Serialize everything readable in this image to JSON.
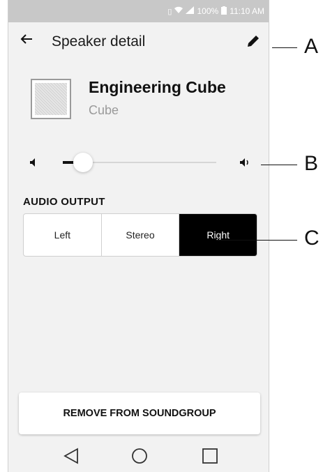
{
  "status_bar": {
    "battery": "100%",
    "time": "11:10 AM",
    "icons": [
      "vibrate-icon",
      "wifi-icon",
      "signal-icon",
      "battery-icon"
    ]
  },
  "app_bar": {
    "title": "Speaker detail",
    "back_icon": "arrow-left-icon",
    "edit_icon": "pencil-icon"
  },
  "speaker": {
    "name": "Engineering Cube",
    "type": "Cube"
  },
  "volume": {
    "level": 0.13,
    "low_icon": "volume-low-icon",
    "high_icon": "volume-high-icon"
  },
  "audio_output": {
    "label": "AUDIO OUTPUT",
    "options": [
      "Left",
      "Stereo",
      "Right"
    ],
    "selected": "Right"
  },
  "remove_button": "REMOVE FROM SOUNDGROUP",
  "nav": [
    "back-triangle-icon",
    "home-circle-icon",
    "recents-square-icon"
  ],
  "callouts": [
    "A",
    "B",
    "C"
  ],
  "colors": {
    "background": "#f2f2f2",
    "status_bar": "#c8c8c8",
    "selected_segment": "#000000",
    "text": "#111111",
    "muted_text": "#9a9a9a"
  }
}
